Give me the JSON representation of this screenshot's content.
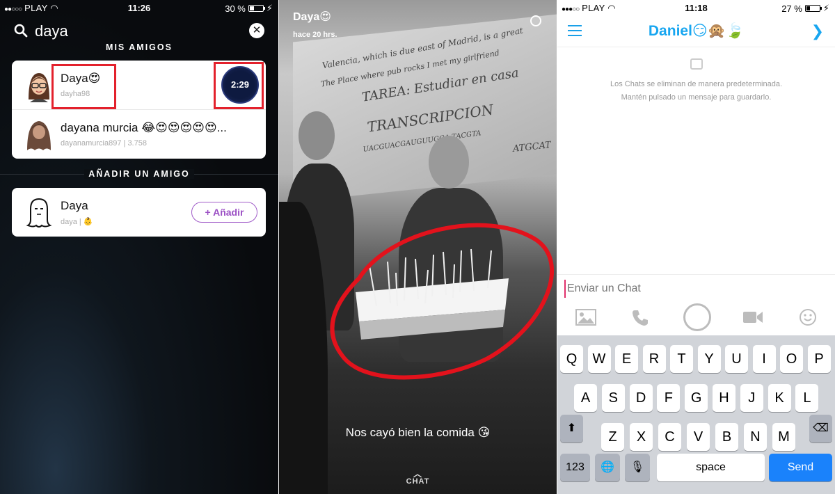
{
  "left_panel": {
    "status": {
      "carrier": "PLAY",
      "time": "11:26",
      "battery": "30 %"
    },
    "search": {
      "query": "daya"
    },
    "my_friends_title": "MIS AMIGOS",
    "friends": [
      {
        "name": "Daya😍",
        "username": "dayha98",
        "story_time": "2:29"
      },
      {
        "name": "dayana murcia  😂😍😍😍😍😍...",
        "username": "dayanamurcia897",
        "score": "3.758"
      }
    ],
    "add_friend_title": "AÑADIR UN AMIGO",
    "suggestions": [
      {
        "name": "Daya",
        "username": "daya",
        "add_label": "+ Añadir"
      }
    ]
  },
  "middle_panel": {
    "sender": "Daya😍",
    "time_ago": "hace 20 hrs.",
    "caption": "Nos cayó bien la comida 😘",
    "chat_hint": "CHAT",
    "board_lines": [
      "Valencia, which is due east of Madrid, is a great",
      "The Place where pub rocks I met my girlfriend",
      "TAREA: Estudiar en casa",
      "TRANSCRIPCION",
      "UACGUACGAUGUUGGA  TACGTA",
      "ATGCAT"
    ]
  },
  "right_panel": {
    "status": {
      "carrier": "PLAY",
      "time": "11:18",
      "battery": "27 %"
    },
    "chat_title": "Daniel😏🙊🍃",
    "notice": [
      "Los Chats se eliminan de manera predeterminada.",
      "Mantén pulsado un mensaje para guardarlo."
    ],
    "input_placeholder": "Enviar un Chat",
    "keyboard": {
      "row1": [
        "Q",
        "W",
        "E",
        "R",
        "T",
        "Y",
        "U",
        "I",
        "O",
        "P"
      ],
      "row2": [
        "A",
        "S",
        "D",
        "F",
        "G",
        "H",
        "J",
        "K",
        "L"
      ],
      "row3": [
        "Z",
        "X",
        "C",
        "V",
        "B",
        "N",
        "M"
      ],
      "numbers": "123",
      "space": "space",
      "send": "Send"
    }
  },
  "colors": {
    "accent_blue": "#18a6f0",
    "highlight_red": "#e3212c",
    "add_purple": "#9b4fc4"
  }
}
